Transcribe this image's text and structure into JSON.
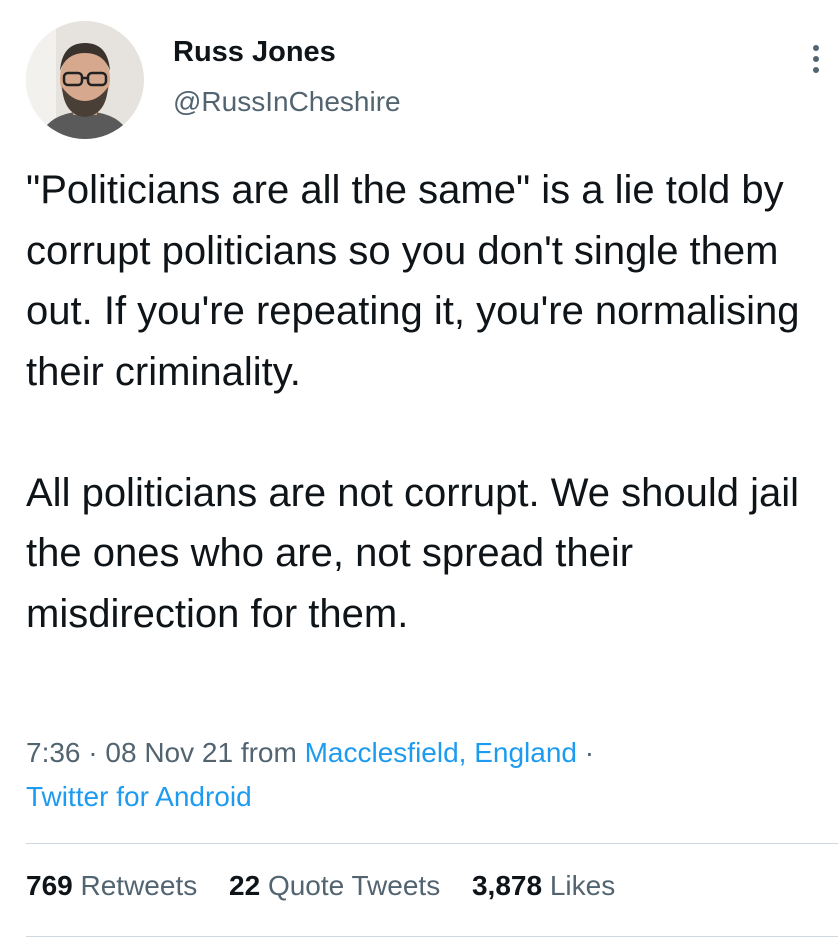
{
  "author": {
    "display_name": "Russ Jones",
    "handle": "@RussInCheshire",
    "avatar_icon": "profile-photo"
  },
  "more_icon": "vertical-ellipsis-icon",
  "tweet": {
    "paragraphs": [
      "\"Politicians are all the same\" is a lie told by corrupt politicians so you don't single them out. If you're repeating it, you're normalising their criminality.",
      "All politicians are not corrupt. We should jail the ones who are, not spread their misdirection for them."
    ]
  },
  "meta": {
    "time": "7:36",
    "separator": "·",
    "date": "08 Nov 21",
    "from_label": "from",
    "location": "Macclesfield, England",
    "source": "Twitter for Android"
  },
  "stats": {
    "retweets_count": "769",
    "retweets_label": "Retweets",
    "quotes_count": "22",
    "quotes_label": "Quote Tweets",
    "likes_count": "3,878",
    "likes_label": "Likes"
  },
  "colors": {
    "text": "#0f1419",
    "secondary": "#536471",
    "link": "#1d9bf0",
    "divider": "#cfd9de"
  }
}
